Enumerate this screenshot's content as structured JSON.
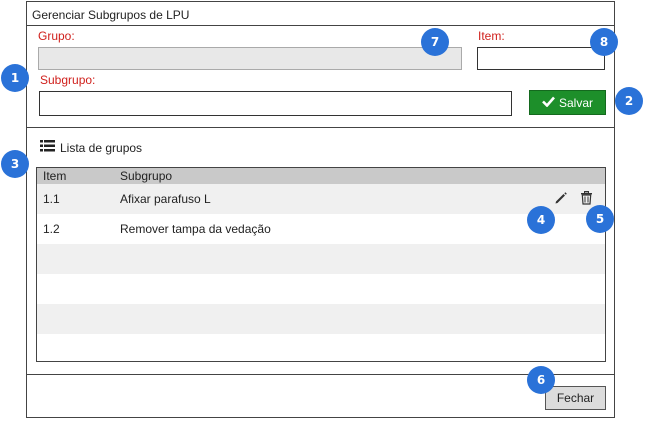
{
  "dialog": {
    "title": "Gerenciar Subgrupos de LPU",
    "grupo_label": "Grupo:",
    "item_label": "Item:",
    "subgrupo_label": "Subgrupo:",
    "grupo_value": "",
    "item_value": "",
    "subgrupo_value": "",
    "save_label": "Salvar",
    "close_label": "Fechar"
  },
  "list": {
    "title": "Lista de grupos",
    "columns": {
      "item": "Item",
      "subgrupo": "Subgrupo"
    },
    "rows": [
      {
        "item": "1.1",
        "subgrupo": "Afixar parafuso L"
      },
      {
        "item": "1.2",
        "subgrupo": "Remover tampa da vedação"
      }
    ],
    "empty_rows": 4
  },
  "annotations": [
    "1",
    "2",
    "3",
    "4",
    "5",
    "6",
    "7",
    "8"
  ],
  "colors": {
    "label_red": "#d0201c",
    "save_green": "#1d8f2a",
    "badge_blue": "#2a72d8",
    "header_gray": "#c9c9c9"
  }
}
